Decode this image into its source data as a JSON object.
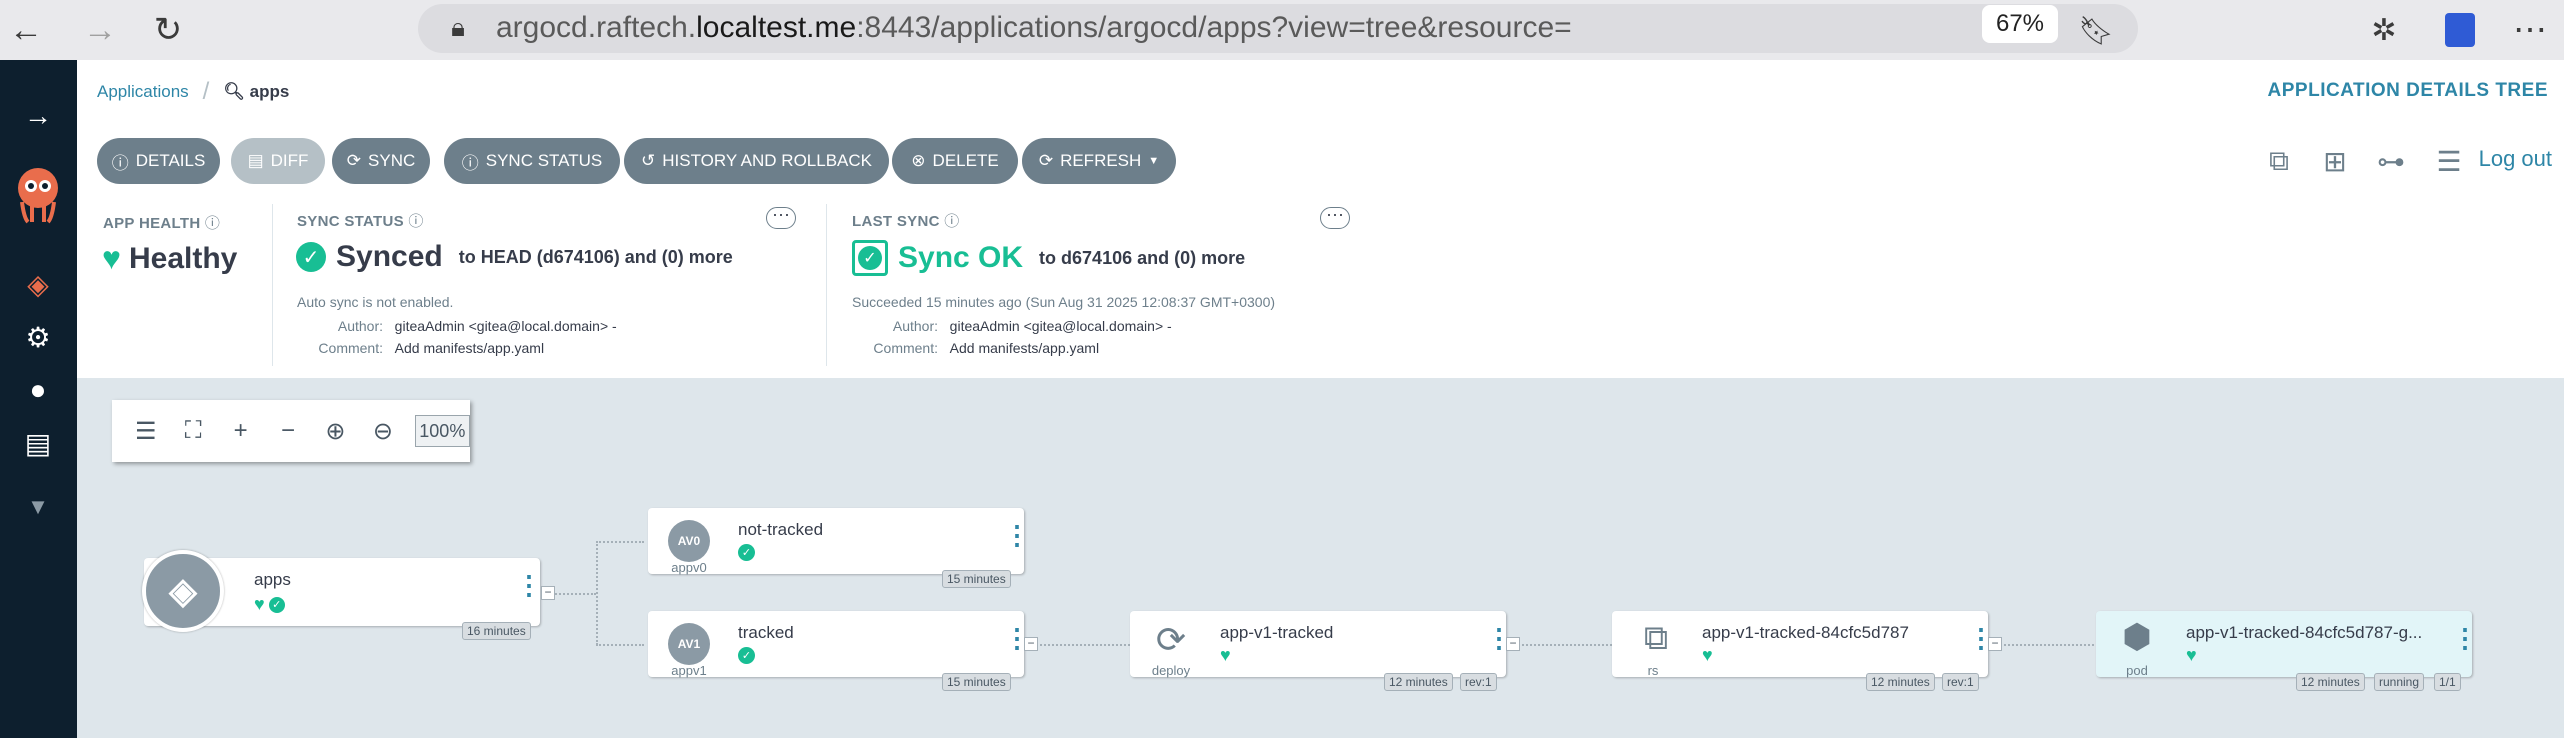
{
  "browser": {
    "url_prefix": "argocd.raftech.",
    "url_host": "localtest.me",
    "url_suffix": ":8443/applications/argocd/apps?view=tree&resource=",
    "zoom": "67%"
  },
  "breadcrumb": {
    "root": "Applications",
    "current": "apps"
  },
  "page_mode": "APPLICATION DETAILS TREE",
  "toolbar": {
    "details": "DETAILS",
    "diff": "DIFF",
    "sync": "SYNC",
    "sync_status": "SYNC STATUS",
    "history": "HISTORY AND ROLLBACK",
    "delete": "DELETE",
    "refresh": "REFRESH"
  },
  "logout": "Log out",
  "app_health": {
    "label": "APP HEALTH",
    "value": "Healthy"
  },
  "sync_status": {
    "label": "SYNC STATUS",
    "value": "Synced",
    "target": "to HEAD (d674106) and (0) more",
    "auto_sync": "Auto sync is not enabled.",
    "author_key": "Author:",
    "author": "giteaAdmin <gitea@local.domain> -",
    "comment_key": "Comment:",
    "comment": "Add manifests/app.yaml"
  },
  "last_sync": {
    "label": "LAST SYNC",
    "value": "Sync OK",
    "target": "to d674106 and (0) more",
    "succeeded": "Succeeded 15 minutes ago (Sun Aug 31 2025 12:08:37 GMT+0300)",
    "author_key": "Author:",
    "author": "giteaAdmin <gitea@local.domain> -",
    "comment_key": "Comment:",
    "comment": "Add manifests/app.yaml"
  },
  "graph": {
    "zoom": "100%"
  },
  "nodes": {
    "apps": {
      "name": "apps",
      "age": "16 minutes"
    },
    "not_tracked": {
      "name": "not-tracked",
      "badge": "AV0",
      "kind": "appv0",
      "age": "15 minutes"
    },
    "tracked": {
      "name": "tracked",
      "badge": "AV1",
      "kind": "appv1",
      "age": "15 minutes"
    },
    "deploy": {
      "name": "app-v1-tracked",
      "kind": "deploy",
      "age": "12 minutes",
      "rev": "rev:1"
    },
    "rs": {
      "name": "app-v1-tracked-84cfc5d787",
      "kind": "rs",
      "age": "12 minutes",
      "rev": "rev:1"
    },
    "pod": {
      "name": "app-v1-tracked-84cfc5d787-g...",
      "kind": "pod",
      "age": "12 minutes",
      "status": "running",
      "ready": "1/1"
    }
  },
  "colors": {
    "accent": "#2e86a7",
    "healthy": "#18be94",
    "sidebar": "#0d1f2e",
    "button": "#6d7f8b"
  }
}
